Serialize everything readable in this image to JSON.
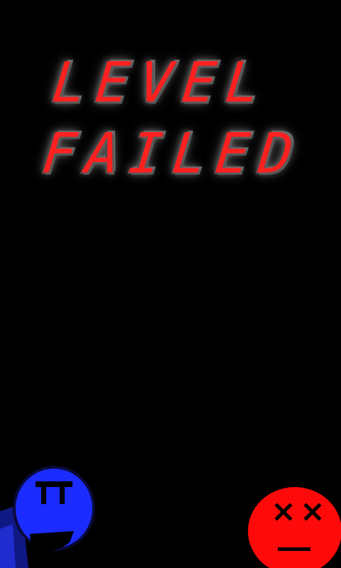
{
  "screen": {
    "background": "#000000"
  },
  "title": {
    "line1": "LEVEL",
    "line2": "FAILED",
    "color": "#ff2020",
    "glow_color": "#6a6a6a"
  },
  "characters": {
    "blue_face": {
      "icon": "happy-blue-face-icon",
      "color": "#1a2cff"
    },
    "red_face": {
      "icon": "dead-red-face-icon",
      "color": "#ff0a0a"
    }
  }
}
